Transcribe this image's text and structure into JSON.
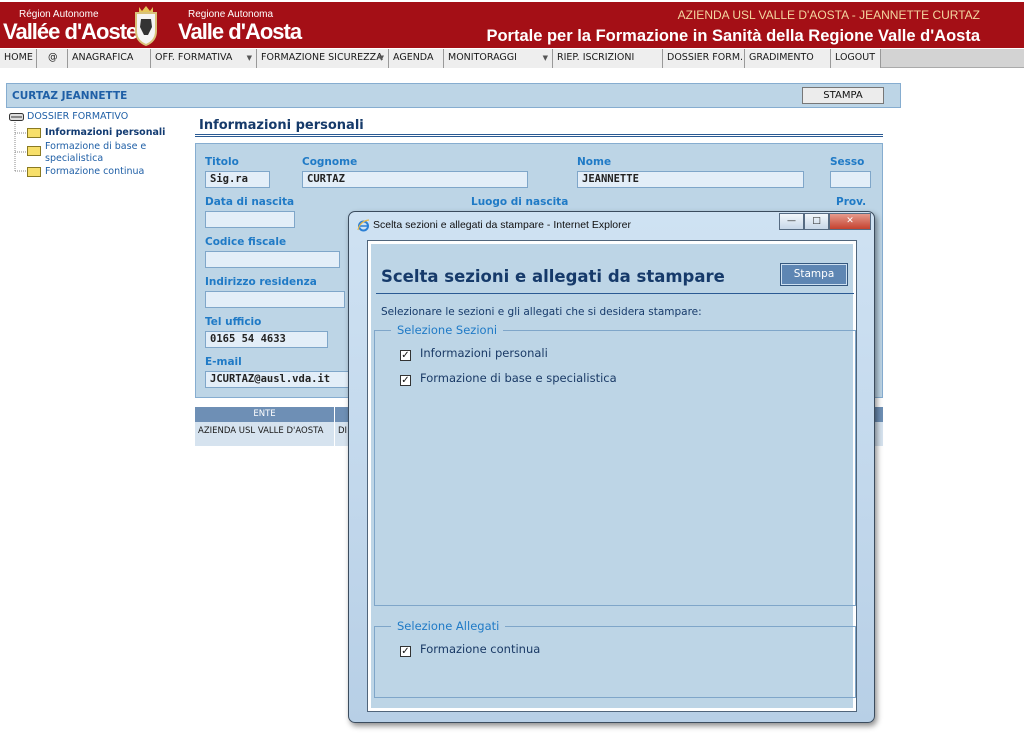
{
  "header": {
    "logo_fr_small": "Région Autonome",
    "logo_fr_big": "Vallée d'Aoste",
    "logo_it_small": "Regione Autonoma",
    "logo_it_big": "Valle d'Aosta",
    "organization": "AZIENDA USL VALLE D'AOSTA - JEANNETTE CURTAZ",
    "portal_title": "Portale per la Formazione in Sanità della Regione Valle d'Aosta",
    "brand_color": "#a40f16"
  },
  "menu": {
    "items": [
      {
        "label": "HOME",
        "arrow": ""
      },
      {
        "label": "@",
        "arrow": ""
      },
      {
        "label": "ANAGRAFICA",
        "arrow": ""
      },
      {
        "label": "OFF. FORMATIVA",
        "arrow": "▼"
      },
      {
        "label": "FORMAZIONE SICUREZZA",
        "arrow": "▼"
      },
      {
        "label": "AGENDA",
        "arrow": ""
      },
      {
        "label": "MONITORAGGI",
        "arrow": "▼"
      },
      {
        "label": "RIEP. ISCRIZIONI",
        "arrow": ""
      },
      {
        "label": "DOSSIER FORM.",
        "arrow": ""
      },
      {
        "label": "GRADIMENTO",
        "arrow": ""
      },
      {
        "label": "LOGOUT",
        "arrow": ""
      }
    ]
  },
  "title_bar": {
    "user_name": "CURTAZ JEANNETTE",
    "print_label": "STAMPA"
  },
  "tree": {
    "root": "DOSSIER FORMATIVO",
    "items": [
      {
        "label": "Informazioni personali"
      },
      {
        "label": "Formazione di base e"
      },
      {
        "label": "specialistica"
      },
      {
        "label": "Formazione continua"
      }
    ]
  },
  "section": {
    "title": "Informazioni personali",
    "labels": {
      "titolo": "Titolo",
      "cognome": "Cognome",
      "nome": "Nome",
      "sesso": "Sesso",
      "data_nascita": "Data di nascita",
      "luogo_nascita": "Luogo di nascita",
      "prov": "Prov.",
      "codice_fiscale": "Codice fiscale",
      "indirizzo": "Indirizzo residenza",
      "tel_ufficio": "Tel ufficio",
      "email": "E-mail"
    },
    "values": {
      "titolo": "Sig.ra",
      "cognome": "CURTAZ",
      "nome": "JEANNETTE",
      "sesso": "",
      "data_nascita": "",
      "codice_fiscale": "",
      "indirizzo": "",
      "tel_ufficio": "0165 54 4633",
      "email": "JCURTAZ@ausl.vda.it"
    }
  },
  "table": {
    "columns": [
      "ENTE",
      ""
    ],
    "rows": [
      [
        "AZIENDA USL VALLE D'AOSTA",
        "DI"
      ]
    ]
  },
  "dialog": {
    "window_title": "Scelta sezioni e allegati da stampare - Internet Explorer",
    "window_buttons": {
      "minimize": "—",
      "maximize": "□",
      "close": "✕"
    },
    "heading": "Scelta sezioni e allegati da stampare",
    "print_button": "Stampa",
    "description": "Selezionare le sezioni e gli allegati che si desidera stampare:",
    "sections_legend": "Selezione Sezioni",
    "sections": [
      {
        "label": "Informazioni personali",
        "checked": true,
        "mark": "✓"
      },
      {
        "label": "Formazione di base e specialistica",
        "checked": true,
        "mark": "✓"
      }
    ],
    "attachments_legend": "Selezione Allegati",
    "attachments": [
      {
        "label": "Formazione continua",
        "checked": true,
        "mark": "✓"
      }
    ]
  }
}
